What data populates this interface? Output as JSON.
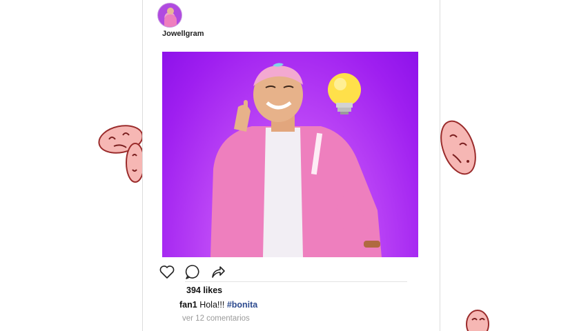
{
  "post": {
    "username": "Jowellgram",
    "likes": "394 likes",
    "caption": {
      "user": "fan1",
      "text": "Hola!!!",
      "hashtag": "#bonita"
    },
    "comments_link": "ver 12 comentarios"
  },
  "actions": {
    "like_icon": "heart-outline",
    "comment_icon": "speech-bubble-outline",
    "share_icon": "share-arrow"
  },
  "colors": {
    "photo_background": "#a51ff0",
    "jacket": "#ee7fbe",
    "emoji_face": "#f6b7b4",
    "hashtag": "#2c4a8f"
  }
}
